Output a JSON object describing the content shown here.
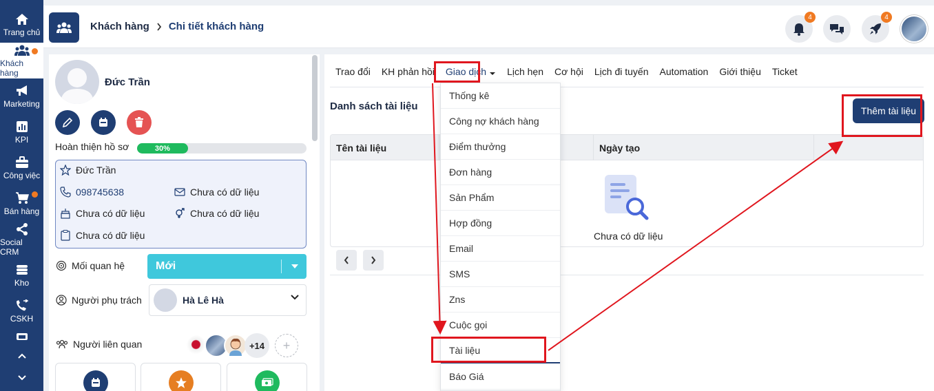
{
  "sidebar": {
    "items": [
      {
        "label": "Trang chủ",
        "icon": "home-icon",
        "dot": false
      },
      {
        "label": "Khách hàng",
        "icon": "users-icon",
        "dot": true
      },
      {
        "label": "Marketing",
        "icon": "megaphone-icon",
        "dot": false
      },
      {
        "label": "KPI",
        "icon": "chart-icon",
        "dot": false
      },
      {
        "label": "Công việc",
        "icon": "briefcase-icon",
        "dot": false
      },
      {
        "label": "Bán hàng",
        "icon": "cart-icon",
        "dot": true
      },
      {
        "label": "Social CRM",
        "icon": "share-icon",
        "dot": false
      },
      {
        "label": "Kho",
        "icon": "warehouse-icon",
        "dot": false
      },
      {
        "label": "CSKH",
        "icon": "phone-transfer-icon",
        "dot": false
      }
    ],
    "accent": "#1f3e73",
    "dot_color": "#f07a22"
  },
  "header": {
    "breadcrumb_root": "Khách hàng",
    "breadcrumb_current": "Chi tiết khách hàng",
    "notification_count": "4",
    "rocket_count": "4"
  },
  "profile": {
    "name": "Đức Trần",
    "completion_label": "Hoàn thiện hồ sơ",
    "completion_value": "30%",
    "completion_fraction": 0.3,
    "info": {
      "full_name": "Đức Trần",
      "phone": "098745638",
      "email": "Chưa có dữ liệu",
      "birthday": "Chưa có dữ liệu",
      "gender": "Chưa có dữ liệu",
      "note": "Chưa có dữ liệu"
    },
    "relationship_label": "Mối quan hệ",
    "relationship_value": "Mới",
    "owner_label": "Người phụ trách",
    "owner_value": "Hà Lê Hà",
    "related_label": "Người liên quan",
    "related_more": "+14",
    "add_symbol": "+"
  },
  "tabs": [
    {
      "label": "Trao đổi"
    },
    {
      "label": "KH phản hồi"
    },
    {
      "label": "Giao dịch"
    },
    {
      "label": "Lịch hẹn"
    },
    {
      "label": "Cơ hội"
    },
    {
      "label": "Lịch đi tuyến"
    },
    {
      "label": "Automation"
    },
    {
      "label": "Giới thiệu"
    },
    {
      "label": "Ticket"
    }
  ],
  "documents": {
    "title": "Danh sách tài liệu",
    "add_button": "Thêm tài liệu",
    "columns": [
      "Tên tài liệu",
      "",
      "Ngày tạo",
      ""
    ],
    "empty_text": "Chưa có dữ liệu"
  },
  "dropdown": {
    "items": [
      "Thống kê",
      "Công nợ khách hàng",
      "Điểm thưởng",
      "Đơn hàng",
      "Sản Phẩm",
      "Hợp đồng",
      "Email",
      "SMS",
      "Zns",
      "Cuộc gọi",
      "Tài liệu",
      "Báo Giá"
    ],
    "selected": "Tài liệu"
  },
  "colors": {
    "primary": "#1f3e73",
    "cyan": "#3fc8dc",
    "green": "#1fba5e",
    "red": "#e55353",
    "orange": "#e67e22",
    "annotation_red": "#e0161e"
  }
}
